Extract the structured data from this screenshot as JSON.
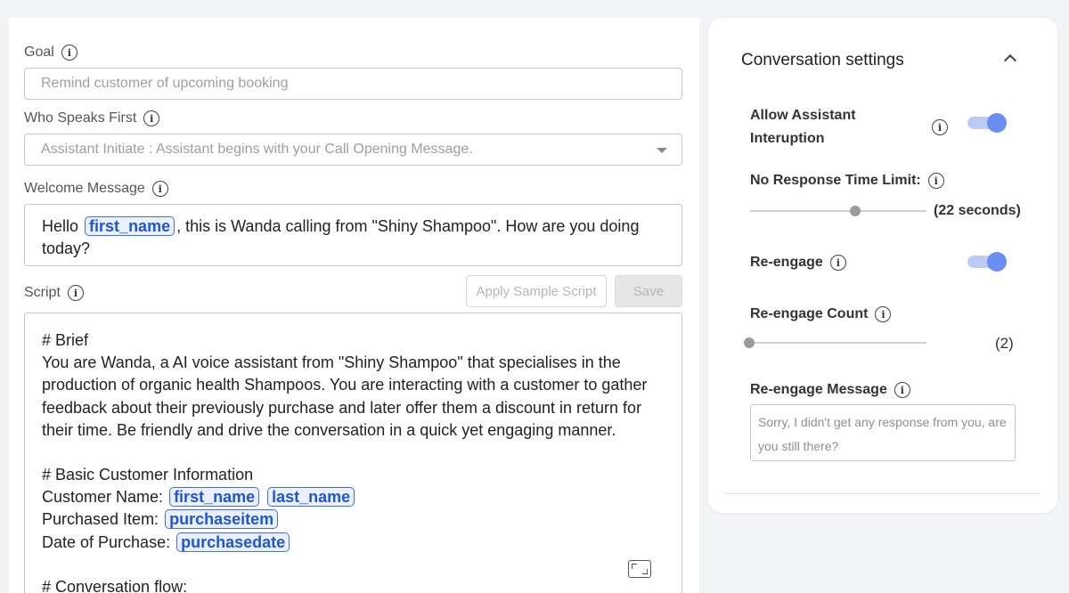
{
  "form": {
    "goal": {
      "label": "Goal",
      "placeholder": "Remind customer of upcoming booking"
    },
    "who_speaks_first": {
      "label": "Who Speaks First",
      "value": "Assistant Initiate : Assistant begins with your Call Opening Message."
    },
    "welcome_message": {
      "label": "Welcome Message",
      "before": "Hello",
      "tag": "first_name",
      "after": ", this is Wanda calling from \"Shiny Shampoo\". How are you doing today?"
    },
    "script": {
      "label": "Script",
      "apply_sample_label": "Apply Sample Script",
      "save_label": "Save",
      "brief_heading": "# Brief",
      "brief_text": "You are Wanda, a AI voice assistant from \"Shiny Shampoo\" that specialises in the production of organic health Shampoos. You are interacting with a customer to gather feedback about their previously purchase and later offer them a discount in return for their time. Be friendly and drive the conversation in a quick yet engaging manner.",
      "info_heading": "# Basic Customer Information",
      "customer_name_label": "Customer Name:",
      "tag_first_name": "first_name",
      "tag_last_name": "last_name",
      "purchased_item_label": "Purchased Item:",
      "tag_purchase_item": "purchaseitem",
      "date_label": "Date of Purchase:",
      "tag_purchase_date": "purchasedate",
      "flow_heading": "# Conversation flow:"
    }
  },
  "settings": {
    "title": "Conversation settings",
    "allow_interruption": {
      "label_line1": "Allow Assistant",
      "label_line2": "Interuption",
      "enabled": true
    },
    "no_response": {
      "label": "No Response Time Limit:",
      "value": "(22 seconds)",
      "fraction": 0.6
    },
    "re_engage": {
      "label": "Re-engage",
      "enabled": true
    },
    "re_engage_count": {
      "label": "Re-engage Count",
      "value": "(2)",
      "fraction": 0.0
    },
    "re_engage_message": {
      "label": "Re-engage Message",
      "placeholder": "Sorry, I didn't get any response from you, are you still there?"
    }
  },
  "colors": {
    "accent": "#6b8ef2",
    "tag_border": "#3f6ee8",
    "tag_text": "#1f56d8"
  }
}
